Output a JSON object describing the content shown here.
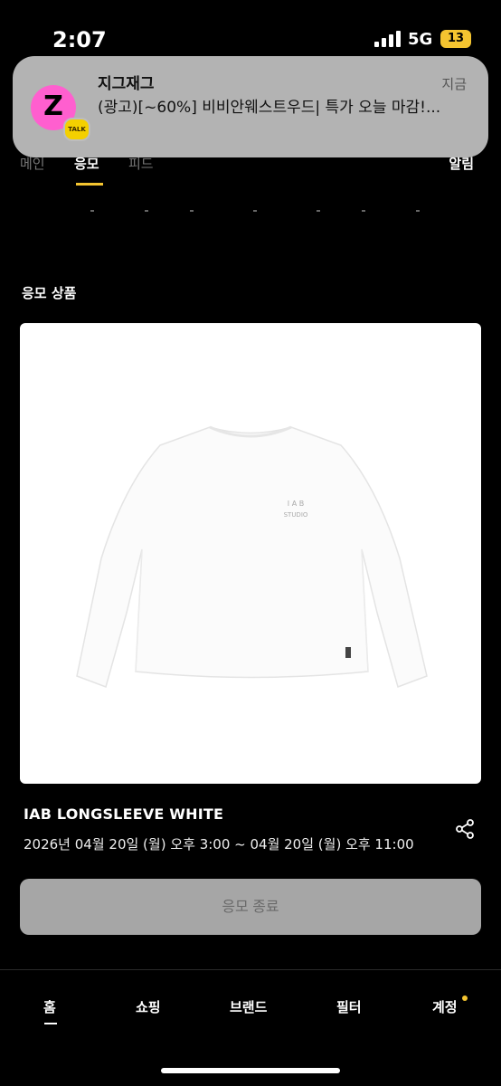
{
  "status": {
    "time": "2:07",
    "network": "5G",
    "battery": "13"
  },
  "notification": {
    "app_name": "지그재그",
    "time": "지금",
    "body": "(광고)[~60%] 비비안웨스트우드| 특가 오늘 마감!...",
    "badge": "TALK",
    "icon_letter": "Z"
  },
  "tabs": {
    "main": "메인",
    "apply": "응모",
    "feed": "피드",
    "notice": "알림"
  },
  "section": {
    "title": "응모 상품"
  },
  "product": {
    "name": "IAB LONGSLEEVE WHITE",
    "date": "2026년 04월 20일 (월) 오후 3:00 ~ 04월 20일 (월) 오후 11:00",
    "print_line1": "I A B",
    "print_line2": "STUDIO",
    "apply_button": "응모 종료"
  },
  "bottom_nav": {
    "home": "홈",
    "shopping": "쇼핑",
    "brand": "브랜드",
    "filter": "필터",
    "account": "계정"
  },
  "colors": {
    "accent": "#f4c430",
    "background": "#000000",
    "button_disabled": "#a6a6a6"
  }
}
